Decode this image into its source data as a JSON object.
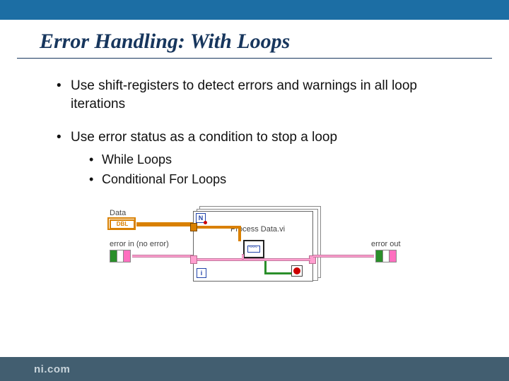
{
  "title": "Error Handling: With Loops",
  "bullets": {
    "b1": "Use shift-registers to detect errors and warnings in all loop iterations",
    "b2": "Use error status as a condition to stop a loop",
    "sub1": "While Loops",
    "sub2": "Conditional For Loops"
  },
  "diagram": {
    "data_label": "Data",
    "dbl_label": "DBL",
    "error_in_label": "error in (no error)",
    "process_vi_label": "Process Data.vi",
    "error_out_label": "error out",
    "n_terminal": "N",
    "i_terminal": "i"
  },
  "footer": {
    "brand": "ni.com"
  }
}
